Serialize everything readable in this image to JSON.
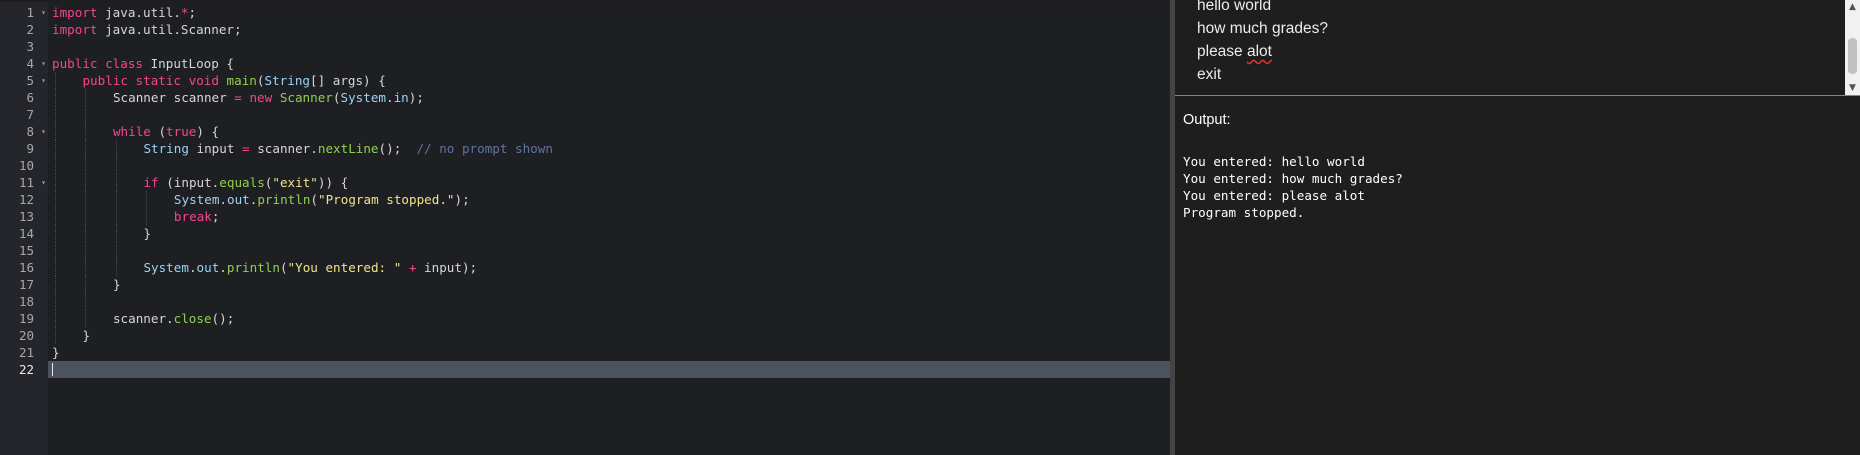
{
  "editor": {
    "active_line": 22,
    "lines": [
      {
        "n": "1",
        "fold": true,
        "indent": 0,
        "tokens": [
          [
            "kw",
            "import"
          ],
          [
            "pl",
            " java.util."
          ],
          [
            "op",
            "*"
          ],
          [
            "pl",
            ";"
          ]
        ]
      },
      {
        "n": "2",
        "fold": false,
        "indent": 0,
        "tokens": [
          [
            "kw",
            "import"
          ],
          [
            "pl",
            " java.util.Scanner;"
          ]
        ]
      },
      {
        "n": "3",
        "fold": false,
        "indent": 0,
        "tokens": []
      },
      {
        "n": "4",
        "fold": true,
        "indent": 0,
        "tokens": [
          [
            "kw",
            "public class"
          ],
          [
            "pl",
            " InputLoop {"
          ]
        ]
      },
      {
        "n": "5",
        "fold": true,
        "indent": 1,
        "tokens": [
          [
            "kw",
            "public static void"
          ],
          [
            "pl",
            " "
          ],
          [
            "fn",
            "main"
          ],
          [
            "pl",
            "("
          ],
          [
            "ty",
            "String"
          ],
          [
            "pl",
            "[] args) {"
          ]
        ]
      },
      {
        "n": "6",
        "fold": false,
        "indent": 2,
        "tokens": [
          [
            "pl",
            "Scanner scanner "
          ],
          [
            "op",
            "="
          ],
          [
            "pl",
            " "
          ],
          [
            "kw",
            "new"
          ],
          [
            "pl",
            " "
          ],
          [
            "fn",
            "Scanner"
          ],
          [
            "pl",
            "("
          ],
          [
            "ty",
            "System"
          ],
          [
            "pl",
            "."
          ],
          [
            "ty",
            "in"
          ],
          [
            "pl",
            ");"
          ]
        ]
      },
      {
        "n": "7",
        "fold": false,
        "indent": 2,
        "tokens": []
      },
      {
        "n": "8",
        "fold": true,
        "indent": 2,
        "tokens": [
          [
            "kw",
            "while"
          ],
          [
            "pl",
            " ("
          ],
          [
            "kw",
            "true"
          ],
          [
            "pl",
            ") {"
          ]
        ]
      },
      {
        "n": "9",
        "fold": false,
        "indent": 3,
        "tokens": [
          [
            "ty",
            "String"
          ],
          [
            "pl",
            " input "
          ],
          [
            "op",
            "="
          ],
          [
            "pl",
            " scanner."
          ],
          [
            "fn",
            "nextLine"
          ],
          [
            "pl",
            "();  "
          ],
          [
            "cm",
            "// no prompt shown"
          ]
        ]
      },
      {
        "n": "10",
        "fold": false,
        "indent": 3,
        "tokens": []
      },
      {
        "n": "11",
        "fold": true,
        "indent": 3,
        "tokens": [
          [
            "kw",
            "if"
          ],
          [
            "pl",
            " (input."
          ],
          [
            "fn",
            "equals"
          ],
          [
            "pl",
            "("
          ],
          [
            "st",
            "\"exit\""
          ],
          [
            "pl",
            ")) {"
          ]
        ]
      },
      {
        "n": "12",
        "fold": false,
        "indent": 4,
        "tokens": [
          [
            "ty",
            "System"
          ],
          [
            "pl",
            "."
          ],
          [
            "ty",
            "out"
          ],
          [
            "pl",
            "."
          ],
          [
            "fn",
            "println"
          ],
          [
            "pl",
            "("
          ],
          [
            "st",
            "\"Program stopped.\""
          ],
          [
            "pl",
            ");"
          ]
        ]
      },
      {
        "n": "13",
        "fold": false,
        "indent": 4,
        "tokens": [
          [
            "kw",
            "break"
          ],
          [
            "pl",
            ";"
          ]
        ]
      },
      {
        "n": "14",
        "fold": false,
        "indent": 3,
        "tokens": [
          [
            "pl",
            "}"
          ]
        ]
      },
      {
        "n": "15",
        "fold": false,
        "indent": 3,
        "tokens": []
      },
      {
        "n": "16",
        "fold": false,
        "indent": 3,
        "tokens": [
          [
            "ty",
            "System"
          ],
          [
            "pl",
            "."
          ],
          [
            "ty",
            "out"
          ],
          [
            "pl",
            "."
          ],
          [
            "fn",
            "println"
          ],
          [
            "pl",
            "("
          ],
          [
            "st",
            "\"You entered: \""
          ],
          [
            "pl",
            " "
          ],
          [
            "op",
            "+"
          ],
          [
            "pl",
            " input);"
          ]
        ]
      },
      {
        "n": "17",
        "fold": false,
        "indent": 2,
        "tokens": [
          [
            "pl",
            "}"
          ]
        ]
      },
      {
        "n": "18",
        "fold": false,
        "indent": 2,
        "tokens": []
      },
      {
        "n": "19",
        "fold": false,
        "indent": 2,
        "tokens": [
          [
            "pl",
            "scanner."
          ],
          [
            "fn",
            "close"
          ],
          [
            "pl",
            "();"
          ]
        ]
      },
      {
        "n": "20",
        "fold": false,
        "indent": 1,
        "tokens": [
          [
            "pl",
            "}"
          ]
        ]
      },
      {
        "n": "21",
        "fold": false,
        "indent": 0,
        "tokens": [
          [
            "pl",
            "}"
          ]
        ]
      },
      {
        "n": "22",
        "fold": false,
        "indent": 0,
        "tokens": []
      }
    ]
  },
  "stdin": {
    "lines": [
      {
        "text": "hello world"
      },
      {
        "text": "how much grades?"
      },
      {
        "pre": "please ",
        "flag": "alot"
      },
      {
        "text": "exit"
      }
    ]
  },
  "output": {
    "label": "Output:",
    "lines": [
      "You entered: hello world",
      "You entered: how much grades?",
      "You entered: please alot",
      "Program stopped."
    ]
  },
  "icons": {
    "fold": "fold-arrow-icon",
    "scroll_up": "scroll-up-arrow-icon",
    "scroll_down": "scroll-down-arrow-icon"
  }
}
